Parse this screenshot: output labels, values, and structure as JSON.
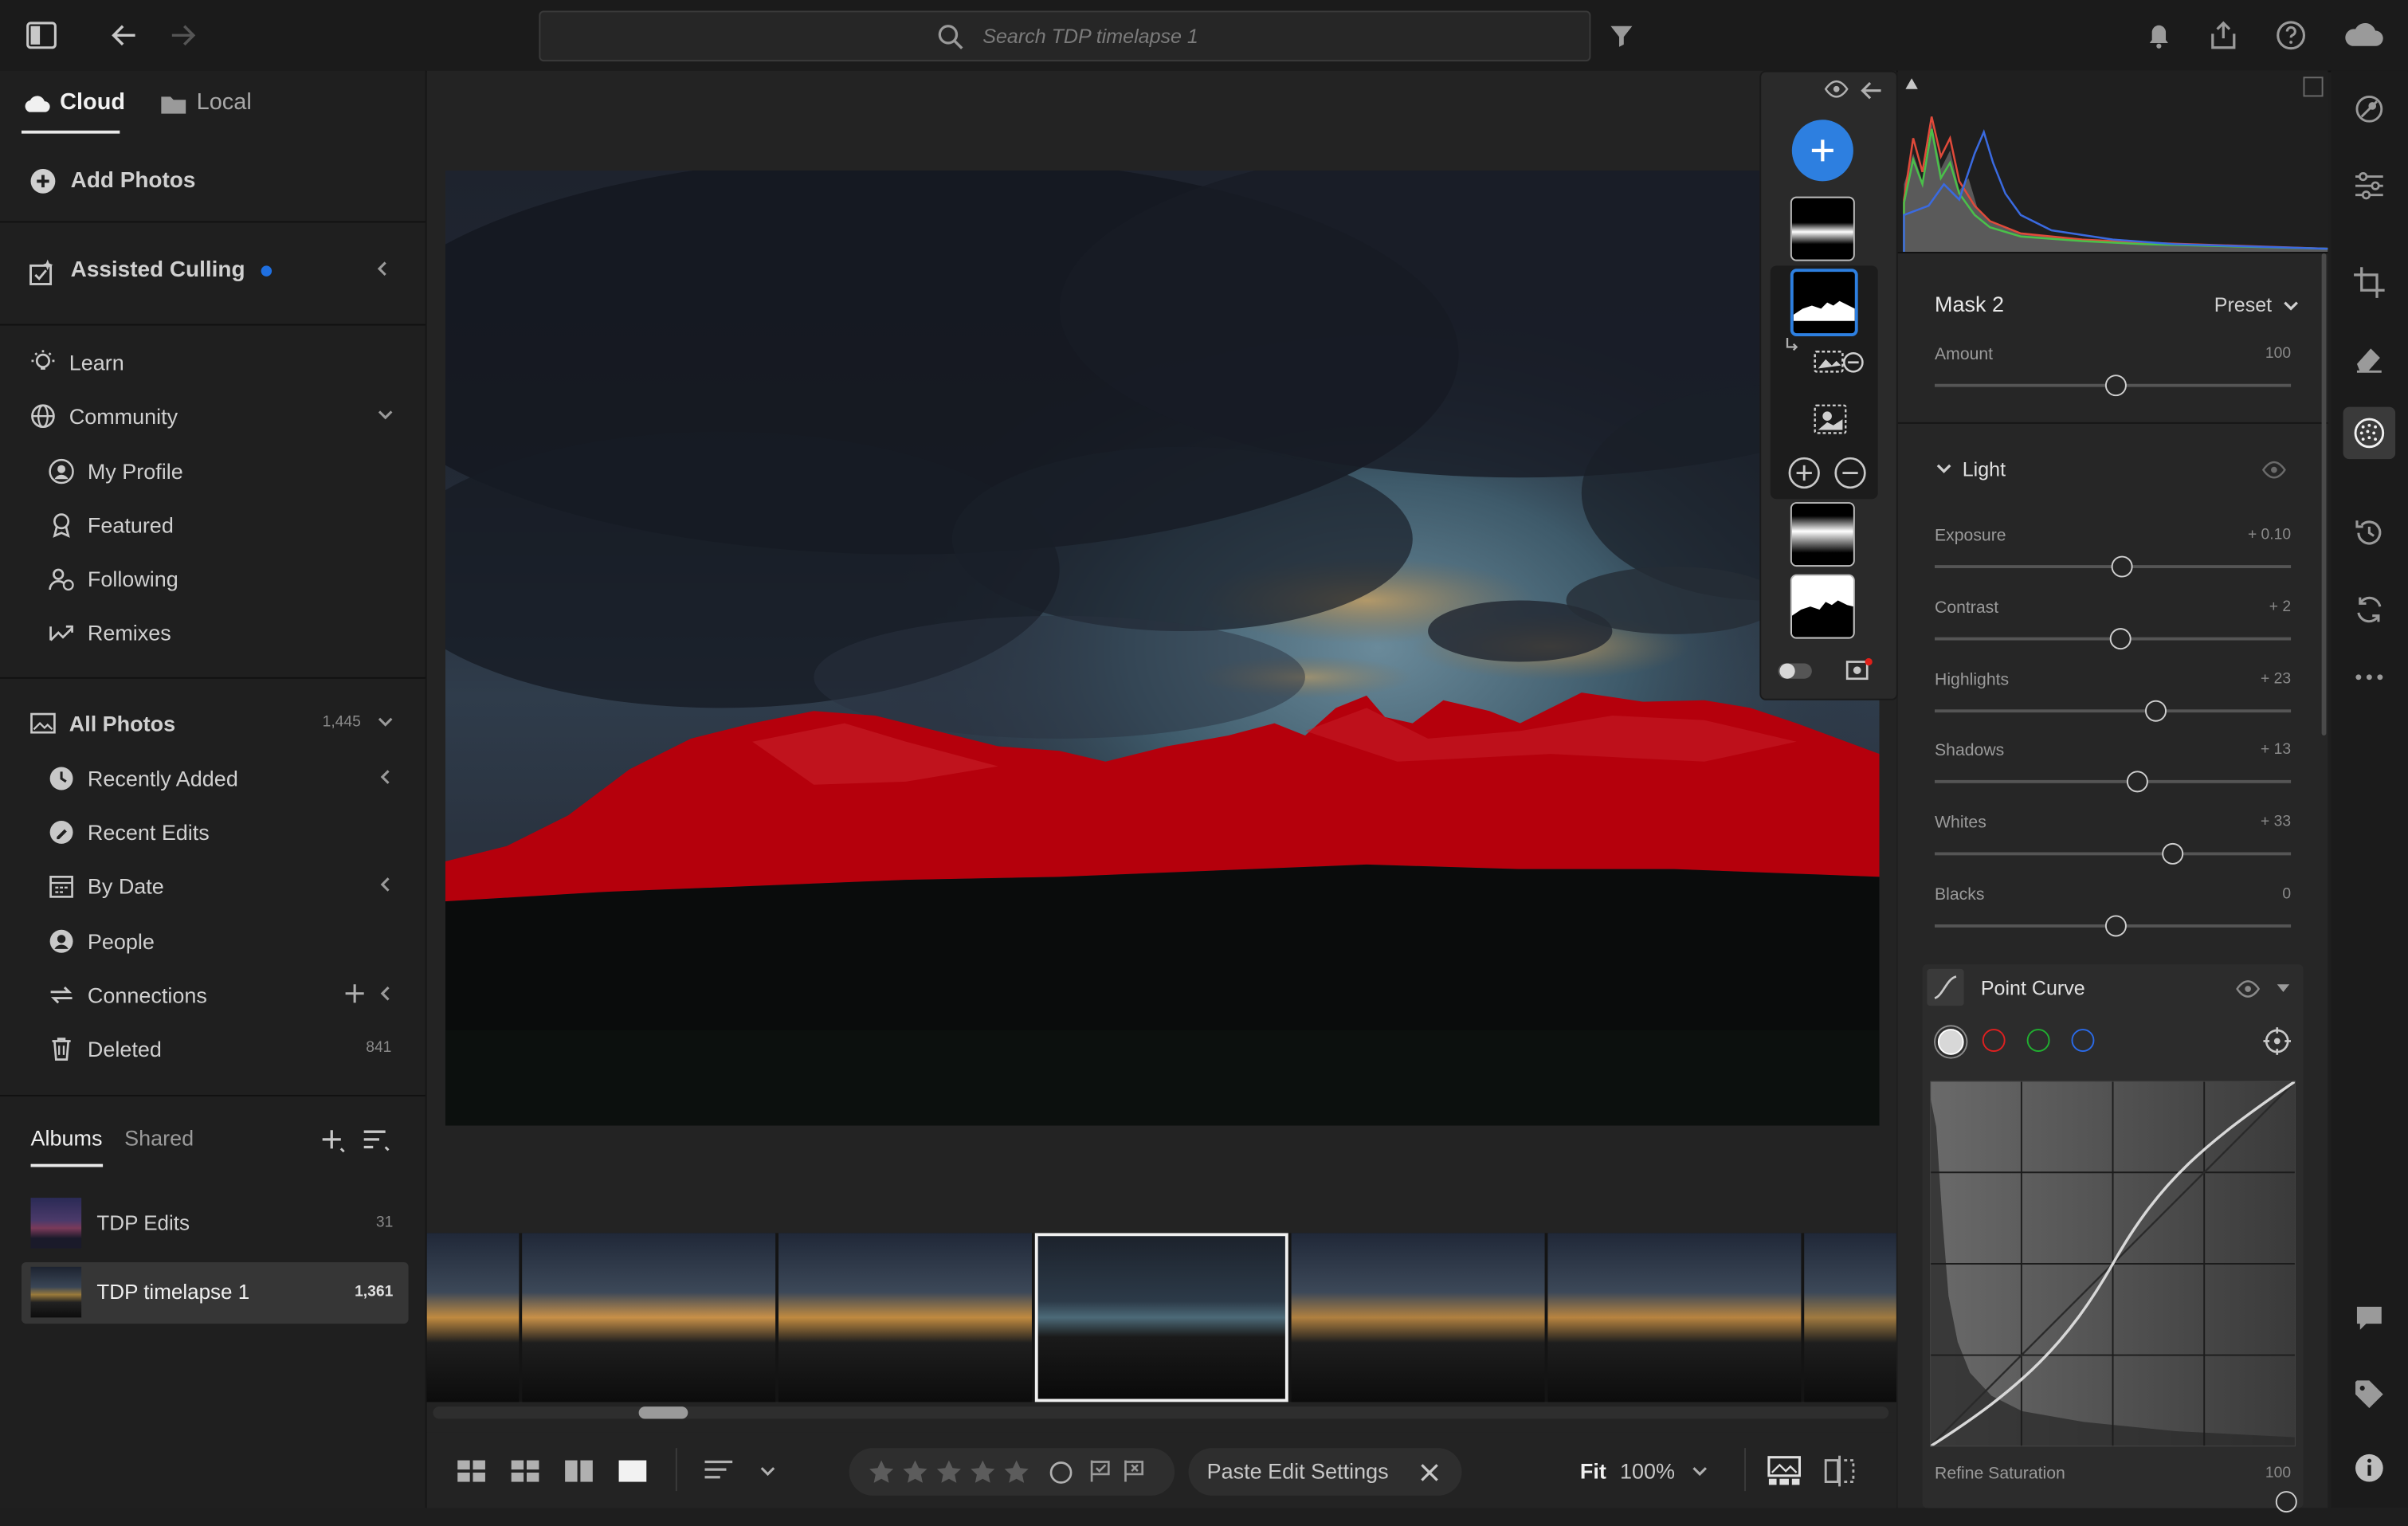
{
  "topbar": {
    "search_placeholder": "Search TDP timelapse 1"
  },
  "left": {
    "tabs": {
      "cloud": "Cloud",
      "local": "Local"
    },
    "add_photos": "Add Photos",
    "assisted_culling": "Assisted Culling",
    "learn": "Learn",
    "community": "Community",
    "community_items": [
      "My Profile",
      "Featured",
      "Following",
      "Remixes"
    ],
    "all_photos": "All Photos",
    "all_photos_count": "1,445",
    "library_items": [
      "Recently Added",
      "Recent Edits",
      "By Date",
      "People",
      "Connections",
      "Deleted"
    ],
    "deleted_count": "841",
    "album_tabs": {
      "albums": "Albums",
      "shared": "Shared"
    },
    "albums": [
      {
        "name": "TDP Edits",
        "count": "31"
      },
      {
        "name": "TDP timelapse 1",
        "count": "1,361"
      }
    ]
  },
  "bottombar": {
    "paste_edit_settings": "Paste Edit Settings",
    "fit": "Fit",
    "zoom": "100%"
  },
  "right": {
    "mask_title": "Mask 2",
    "preset": "Preset",
    "amount": {
      "label": "Amount",
      "value": "100",
      "level": 0.51
    },
    "light_title": "Light",
    "light_sliders": [
      {
        "label": "Exposure",
        "value": "+ 0.10",
        "level": 0.525
      },
      {
        "label": "Contrast",
        "value": "+ 2",
        "level": 0.52
      },
      {
        "label": "Highlights",
        "value": "+ 23",
        "level": 0.62
      },
      {
        "label": "Shadows",
        "value": "+ 13",
        "level": 0.57
      },
      {
        "label": "Whites",
        "value": "+ 33",
        "level": 0.67
      },
      {
        "label": "Blacks",
        "value": "0",
        "level": 0.51
      }
    ],
    "point_curve": "Point Curve",
    "refine_saturation": {
      "label": "Refine Saturation",
      "value": "100"
    }
  },
  "colors": {
    "accent_blue": "#2d7fe0",
    "mask_overlay": "#c00010",
    "culling_dot": "#1f6fe0"
  }
}
